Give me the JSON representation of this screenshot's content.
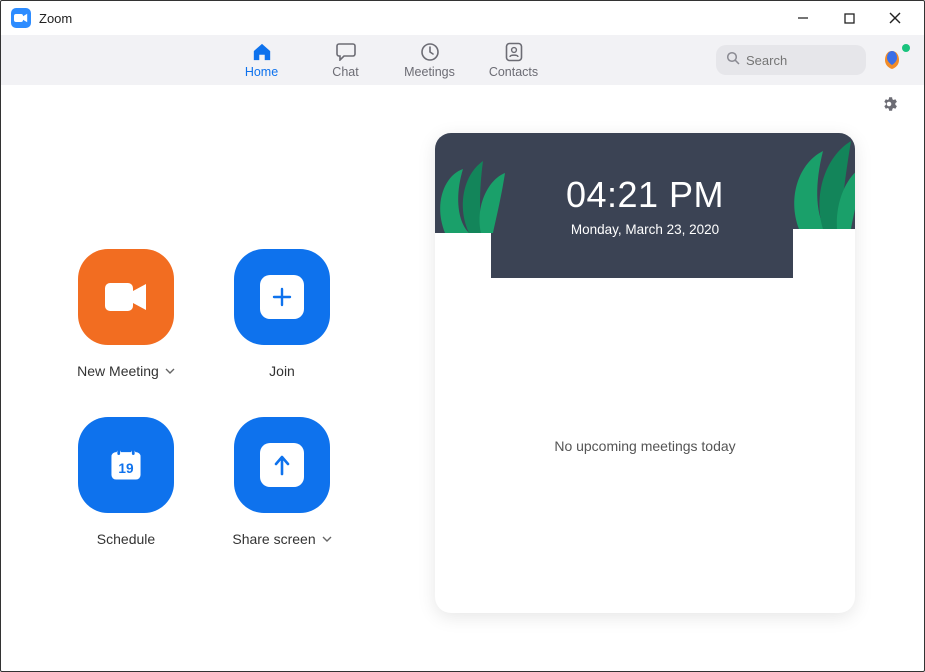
{
  "app": {
    "title": "Zoom"
  },
  "nav": {
    "home": "Home",
    "chat": "Chat",
    "meetings": "Meetings",
    "contacts": "Contacts"
  },
  "search": {
    "placeholder": "Search"
  },
  "tiles": {
    "new_meeting": "New Meeting",
    "join": "Join",
    "schedule": "Schedule",
    "schedule_day": "19",
    "share_screen": "Share screen"
  },
  "calendar": {
    "time": "04:21 PM",
    "date": "Monday, March 23, 2020",
    "empty": "No upcoming meetings today"
  }
}
